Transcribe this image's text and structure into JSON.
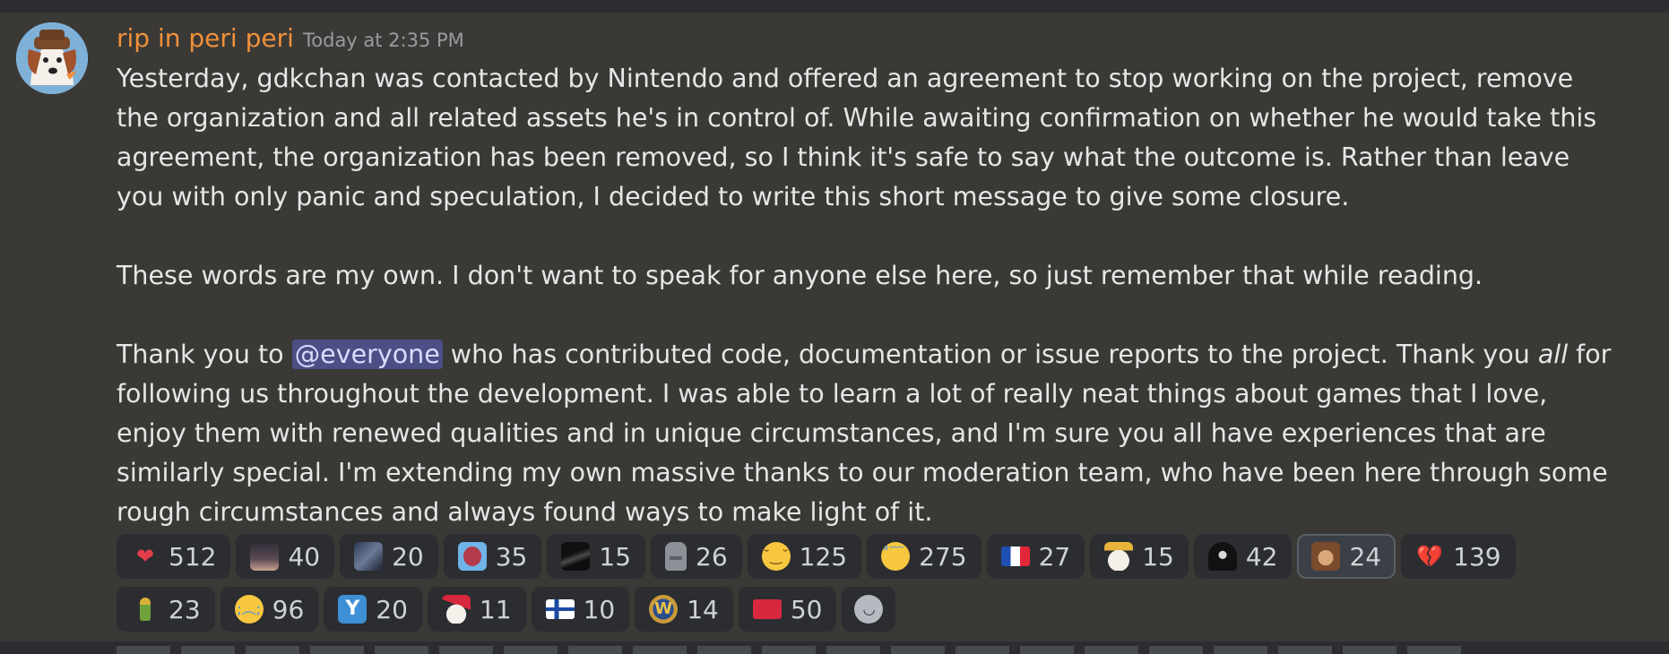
{
  "message": {
    "author": "rip in peri peri",
    "timestamp": "Today at 2:35 PM",
    "paragraph1": "Yesterday, gdkchan was contacted by Nintendo and offered an agreement to stop working on the project, remove the organization and all related assets he's in control of. While awaiting confirmation on whether he would take this agreement, the organization has been removed, so I think it's safe to say what the outcome is. Rather than leave you with only panic and speculation, I decided to write this short message to give some closure.",
    "paragraph2": "These words are my own. I don't want to speak for anyone else here, so just remember that while reading.",
    "paragraph3_pre": "Thank you to ",
    "mention": "@everyone",
    "paragraph3_mid": " who has contributed code, documentation or issue reports to the project. Thank you ",
    "paragraph3_em": "all",
    "paragraph3_post": " for following us throughout the development. I was able to learn a lot of really neat things about games that I love, enjoy them with renewed qualities and in unique circumstances, and I'm sure you all have experiences that are similarly special. I'm extending my own massive thanks to our moderation team, who have been here through some rough circumstances and always found ways to make light of it."
  },
  "reactions": [
    {
      "icon": "red-heart-icon",
      "count": "512"
    },
    {
      "icon": "person-emote-icon",
      "count": "40"
    },
    {
      "icon": "pixel-scene-icon",
      "count": "20"
    },
    {
      "icon": "blue-frame-icon",
      "count": "35"
    },
    {
      "icon": "dark-scene-icon",
      "count": "15"
    },
    {
      "icon": "moai-icon",
      "count": "26"
    },
    {
      "icon": "relieved-face-icon",
      "count": "125"
    },
    {
      "icon": "loudly-crying-face-icon",
      "count": "275"
    },
    {
      "icon": "france-flag-icon",
      "count": "27"
    },
    {
      "icon": "party-dog-icon",
      "count": "15"
    },
    {
      "icon": "hooded-figure-icon",
      "count": "42"
    },
    {
      "icon": "monkey-face-icon",
      "count": "24",
      "selected": true
    },
    {
      "icon": "broken-heart-icon",
      "count": "139"
    },
    {
      "icon": "bottle-icon",
      "count": "23"
    },
    {
      "icon": "crying-face-icon",
      "count": "96"
    },
    {
      "icon": "y-letter-icon",
      "count": "20"
    },
    {
      "icon": "santa-dog-icon",
      "count": "11"
    },
    {
      "icon": "finland-flag-icon",
      "count": "10"
    },
    {
      "icon": "warcraft-logo-icon",
      "count": "14"
    },
    {
      "icon": "palestine-flag-icon",
      "count": "50"
    }
  ],
  "colors": {
    "background": "#3a3936",
    "author": "#f0913b",
    "timestamp": "#9a9ba0",
    "text": "#e6e6e6",
    "mention_bg": "#4b4f86",
    "reaction_bg": "#2b2d31"
  }
}
